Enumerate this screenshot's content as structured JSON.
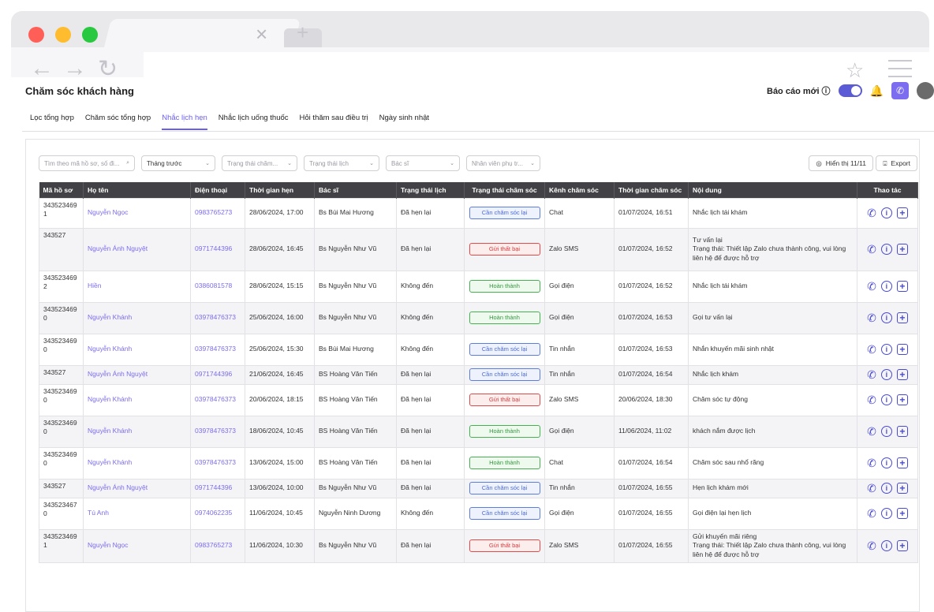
{
  "browser": {
    "colors": {
      "red": "#ff5f57",
      "yellow": "#febc2e",
      "green": "#28c840"
    },
    "tab_close": "×",
    "tab_new": "+",
    "back_icon": "←",
    "forward_icon": "→",
    "reload_icon": "↻",
    "star_icon": "☆"
  },
  "header": {
    "title": "Chăm sóc khách hàng",
    "report_label": "Báo cáo mới ⓘ",
    "bell_icon": "🔔",
    "phone_icon": "✆"
  },
  "tabs": [
    {
      "label": "Lọc tổng hợp"
    },
    {
      "label": "Chăm sóc tổng hợp"
    },
    {
      "label": "Nhắc lịch hẹn"
    },
    {
      "label": "Nhắc lịch uống thuốc"
    },
    {
      "label": "Hỏi thăm sau điều trị"
    },
    {
      "label": "Ngày sinh nhật"
    }
  ],
  "filters": {
    "search_placeholder": "Tìm theo mã hồ sơ, số đi...",
    "search_icon": "⌕",
    "month": "Tháng trước",
    "care_status": "Trạng thái chăm...",
    "appt_status": "Trạng thái lịch",
    "doctor": "Bác sĩ",
    "staff": "Nhân viên phụ tr...",
    "chevron": "⌄"
  },
  "toolbar": {
    "show_label": "Hiển thị 11/11",
    "eye_icon": "◎",
    "export_label": "Export",
    "export_icon": "⍗"
  },
  "table": {
    "headers": [
      "Mã hồ sơ",
      "Họ tên",
      "Điện thoại",
      "Thời gian hẹn",
      "Bác sĩ",
      "Trạng thái lịch",
      "Trạng thái chăm sóc",
      "Kênh chăm sóc",
      "Thời gian chăm sóc",
      "Nội dung",
      "Thao tác"
    ],
    "action_icons": {
      "phone": "✆",
      "info": "i",
      "add": "+"
    },
    "rows": [
      {
        "id": "343523469\n1",
        "name": "Nguyễn Ngọc",
        "phone": "0983765273",
        "appt": "28/06/2024, 17:00",
        "doctor": "Bs Bùi Mai Hương",
        "appt_status": "Đã hẹn lại",
        "care_status": "Cần chăm sóc lại",
        "care_type": "blue",
        "channel": "Chat",
        "care_time": "01/07/2024, 16:51",
        "content": "Nhắc lịch tái khám"
      },
      {
        "id": "343527",
        "name": "Nguyễn Ánh Nguyệt",
        "phone": "0971744396",
        "appt": "28/06/2024, 16:45",
        "doctor": "Bs Nguyễn Như Vũ",
        "appt_status": "Đã hẹn lại",
        "care_status": "Gửi thất bại",
        "care_type": "red",
        "channel": "Zalo SMS",
        "care_time": "01/07/2024, 16:52",
        "content": "Tư vấn lại\nTrạng thái: Thiết lập Zalo chưa thành công, vui lòng liên hệ để được hỗ trợ"
      },
      {
        "id": "343523469\n2",
        "name": "Hiền",
        "phone": "0386081578",
        "appt": "28/06/2024, 15:15",
        "doctor": "Bs Nguyễn Như Vũ",
        "appt_status": "Không đến",
        "care_status": "Hoàn thành",
        "care_type": "green",
        "channel": "Gọi điện",
        "care_time": "01/07/2024, 16:52",
        "content": "Nhắc lịch tái khám"
      },
      {
        "id": "343523469\n0",
        "name": "Nguyễn Khánh",
        "phone": "03978476373",
        "appt": "25/06/2024, 16:00",
        "doctor": "Bs Nguyễn Như Vũ",
        "appt_status": "Không đến",
        "care_status": "Hoàn thành",
        "care_type": "green",
        "channel": "Gọi điện",
        "care_time": "01/07/2024, 16:53",
        "content": "Gọi tư vấn lại"
      },
      {
        "id": "343523469\n0",
        "name": "Nguyễn Khánh",
        "phone": "03978476373",
        "appt": "25/06/2024, 15:30",
        "doctor": "Bs Bùi Mai Hương",
        "appt_status": "Không đến",
        "care_status": "Cần chăm sóc lại",
        "care_type": "blue",
        "channel": "Tin nhắn",
        "care_time": "01/07/2024, 16:53",
        "content": "Nhắn khuyến mãi sinh nhật"
      },
      {
        "id": "343527",
        "name": "Nguyễn Ánh Nguyệt",
        "phone": "0971744396",
        "appt": "21/06/2024, 16:45",
        "doctor": "BS Hoàng Văn Tiến",
        "appt_status": "Đã hẹn lại",
        "care_status": "Cần chăm sóc lại",
        "care_type": "blue",
        "channel": "Tin nhắn",
        "care_time": "01/07/2024, 16:54",
        "content": "Nhắc lịch khám"
      },
      {
        "id": "343523469\n0",
        "name": "Nguyễn Khánh",
        "phone": "03978476373",
        "appt": "20/06/2024, 18:15",
        "doctor": "BS Hoàng Văn Tiến",
        "appt_status": "Đã hẹn lại",
        "care_status": "Gửi thất bại",
        "care_type": "red",
        "channel": "Zalo SMS",
        "care_time": "20/06/2024, 18:30",
        "content": "Chăm sóc tự động"
      },
      {
        "id": "343523469\n0",
        "name": "Nguyễn Khánh",
        "phone": "03978476373",
        "appt": "18/06/2024, 10:45",
        "doctor": "BS Hoàng Văn Tiến",
        "appt_status": "Đã hẹn lại",
        "care_status": "Hoàn thành",
        "care_type": "green",
        "channel": "Gọi điện",
        "care_time": "11/06/2024, 11:02",
        "content": "khách nắm được lịch"
      },
      {
        "id": "343523469\n0",
        "name": "Nguyễn Khánh",
        "phone": "03978476373",
        "appt": "13/06/2024, 15:00",
        "doctor": "BS Hoàng Văn Tiến",
        "appt_status": "Đã hẹn lại",
        "care_status": "Hoàn thành",
        "care_type": "green",
        "channel": "Chat",
        "care_time": "01/07/2024, 16:54",
        "content": "Chăm sóc sau nhổ răng"
      },
      {
        "id": "343527",
        "name": "Nguyễn Ánh Nguyệt",
        "phone": "0971744396",
        "appt": "13/06/2024, 10:00",
        "doctor": "Bs Nguyễn Như Vũ",
        "appt_status": "Đã hẹn lại",
        "care_status": "Cần chăm sóc lại",
        "care_type": "blue",
        "channel": "Tin nhắn",
        "care_time": "01/07/2024, 16:55",
        "content": "Hẹn lịch khám mới"
      },
      {
        "id": "343523467\n0",
        "name": "Tú Anh",
        "phone": "0974062235",
        "appt": "11/06/2024, 10:45",
        "doctor": "Nguyễn Ninh Dương",
        "appt_status": "Không đến",
        "care_status": "Cần chăm sóc lại",
        "care_type": "blue",
        "channel": "Gọi điện",
        "care_time": "01/07/2024, 16:55",
        "content": "Gọi điện lại hẹn lịch"
      },
      {
        "id": "343523469\n1",
        "name": "Nguyễn Ngọc",
        "phone": "0983765273",
        "appt": "11/06/2024, 10:30",
        "doctor": "Bs Nguyễn Như Vũ",
        "appt_status": "Đã hẹn lại",
        "care_status": "Gửi thất bại",
        "care_type": "red",
        "channel": "Zalo SMS",
        "care_time": "01/07/2024, 16:55",
        "content": "Gửi khuyến mãi riêng\nTrạng thái: Thiết lập Zalo chưa thành công, vui lòng liên hệ để được hỗ trợ"
      }
    ]
  }
}
